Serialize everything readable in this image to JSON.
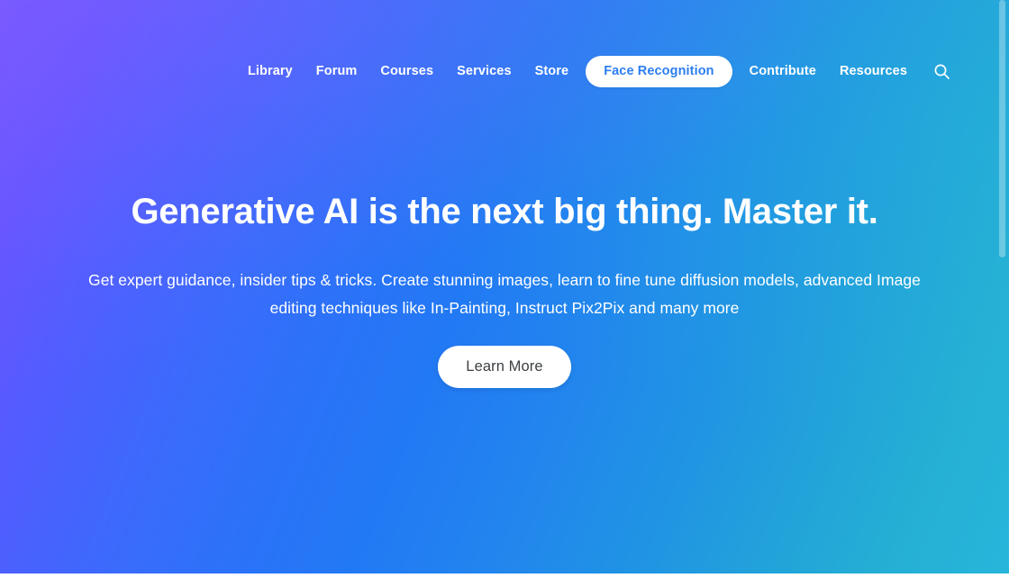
{
  "nav": {
    "items": [
      {
        "label": "Library",
        "active": false
      },
      {
        "label": "Forum",
        "active": false
      },
      {
        "label": "Courses",
        "active": false
      },
      {
        "label": "Services",
        "active": false
      },
      {
        "label": "Store",
        "active": false
      },
      {
        "label": "Face Recognition",
        "active": true
      },
      {
        "label": "Contribute",
        "active": false
      },
      {
        "label": "Resources",
        "active": false
      }
    ],
    "search_icon": "search-icon"
  },
  "hero": {
    "title": "Generative AI is the next big thing. Master it.",
    "subtitle": "Get expert guidance, insider tips & tricks. Create stunning images, learn to fine tune diffusion models, advanced Image editing techniques like In-Painting, Instruct Pix2Pix and many more",
    "cta_label": "Learn More"
  },
  "colors": {
    "gradient_start": "#6f52ff",
    "gradient_mid": "#2279f4",
    "gradient_end": "#27b6db",
    "active_pill_bg": "#ffffff",
    "active_pill_text": "#2c7ef0",
    "cta_bg": "#ffffff",
    "cta_text": "#3c4043",
    "nav_text": "#ffffff",
    "footer_strip": "#ffffff"
  }
}
